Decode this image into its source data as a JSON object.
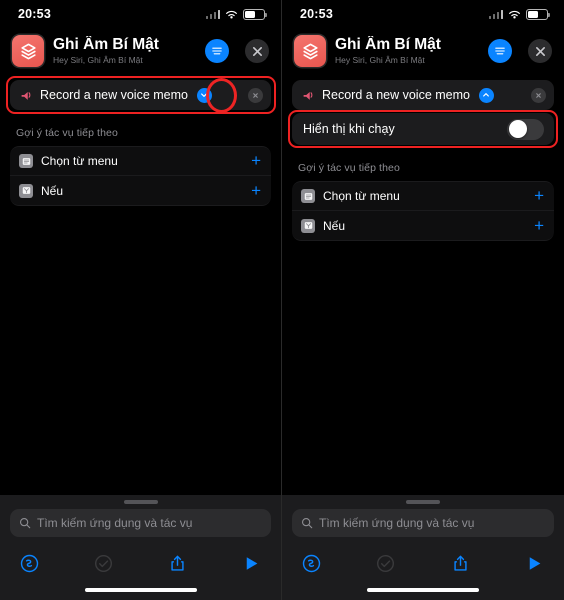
{
  "status_bar": {
    "time": "20:53",
    "signal_icon": "cellular-bars-icon",
    "wifi_icon": "wifi-icon",
    "battery_icon": "battery-icon"
  },
  "header": {
    "app_icon": "shortcuts-layers-icon",
    "title": "Ghi Âm Bí Mật",
    "subtitle": "Hey Siri, Ghi Âm Bí Mật",
    "settings_icon": "sliders-icon",
    "close_icon": "close-icon"
  },
  "action": {
    "glyph_icon": "voice-memo-icon",
    "label": "Record a new voice memo",
    "disclosure_icon": "chevron-down-icon",
    "remove_icon": "close-icon"
  },
  "parameter": {
    "label": "Hiển thị khi chạy",
    "toggle_state": "off"
  },
  "suggestions": {
    "title": "Gợi ý tác vụ tiếp theo",
    "items": [
      {
        "icon": "menu-list-icon",
        "label": "Chọn từ menu",
        "add_icon": "plus-icon"
      },
      {
        "icon": "if-branch-icon",
        "label": "Nếu",
        "add_icon": "plus-icon"
      }
    ]
  },
  "search": {
    "icon": "search-icon",
    "placeholder": "Tìm kiếm ứng dụng và tác vụ"
  },
  "toolbar": {
    "siri_icon": "siri-record-icon",
    "clock_icon": "automation-clock-icon-disabled",
    "share_icon": "share-icon",
    "play_icon": "play-icon"
  },
  "colors": {
    "accent": "#0a84ff",
    "annotation": "#ee2222",
    "app_icon": "#e8564f",
    "card": "#1c1c1e",
    "muted_text": "#8e8e93"
  },
  "panels": {
    "left_caption": "collapsed-action-highlighted",
    "right_caption": "expanded-action-show-when-run"
  }
}
